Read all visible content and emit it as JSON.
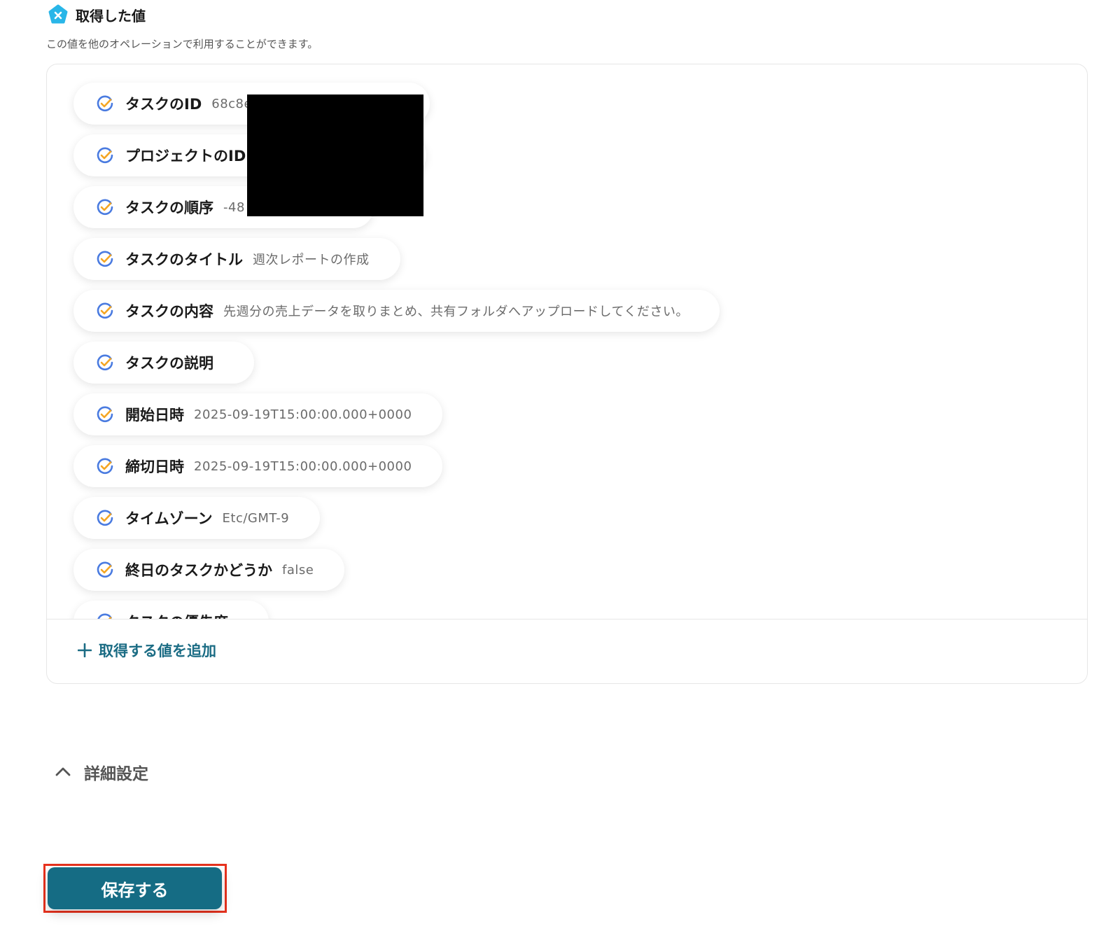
{
  "section": {
    "title": "取得した値",
    "description": "この値を他のオペレーションで利用することができます。"
  },
  "values": [
    {
      "label": "タスクのID",
      "value": "68c8e"
    },
    {
      "label": "プロジェクトのID",
      "value": ""
    },
    {
      "label": "タスクの順序",
      "value": "-48"
    },
    {
      "label": "タスクのタイトル",
      "value": "週次レポートの作成"
    },
    {
      "label": "タスクの内容",
      "value": "先週分の売上データを取りまとめ、共有フォルダへアップロードしてください。"
    },
    {
      "label": "タスクの説明",
      "value": ""
    },
    {
      "label": "開始日時",
      "value": "2025-09-19T15:00:00.000+0000"
    },
    {
      "label": "締切日時",
      "value": "2025-09-19T15:00:00.000+0000"
    },
    {
      "label": "タイムゾーン",
      "value": "Etc/GMT-9"
    },
    {
      "label": "終日のタスクかどうか",
      "value": "false"
    },
    {
      "label": "タスクの優先度",
      "value": ""
    }
  ],
  "add_value_label": "取得する値を追加",
  "advanced_settings_label": "詳細設定",
  "save_label": "保存する",
  "colors": {
    "accent": "#156c84",
    "badge": "#29b6e8",
    "check_blue": "#4a7be0",
    "check_orange": "#f5a623",
    "highlight": "#e8321e"
  },
  "icons": {
    "section_badge": "close-badge-icon",
    "value_check": "check-circle-icon",
    "add": "plus-icon",
    "advanced": "chevron-up-icon"
  }
}
